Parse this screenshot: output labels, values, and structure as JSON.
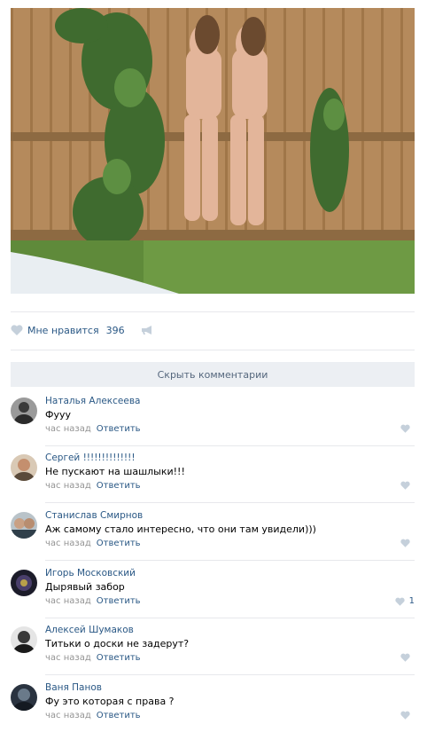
{
  "post": {
    "likes_label": "Мне нравится",
    "likes_count": "396",
    "hide_comments_label": "Скрыть комментарии"
  },
  "colors": {
    "link": "#2a5885",
    "muted": "#939393",
    "icon": "#c5d0db",
    "button_bg": "#eceff3"
  },
  "comments": [
    {
      "author": "Наталья Алексеева",
      "text": "Фууу",
      "time": "час назад",
      "reply": "Ответить",
      "likes": ""
    },
    {
      "author": "Сергей !!!!!!!!!!!!!!",
      "text": "Не пускают на шашлыки!!!",
      "time": "час назад",
      "reply": "Ответить",
      "likes": ""
    },
    {
      "author": "Станислав Смирнов",
      "text": "Аж самому стало интересно, что они там увидели)))",
      "time": "час назад",
      "reply": "Ответить",
      "likes": ""
    },
    {
      "author": "Игорь Московский",
      "text": "Дырявый забор",
      "time": "час назад",
      "reply": "Ответить",
      "likes": "1"
    },
    {
      "author": "Алексей Шумаков",
      "text": "Титьки о доски не задерут?",
      "time": "час назад",
      "reply": "Ответить",
      "likes": ""
    },
    {
      "author": "Ваня Панов",
      "text": "Фу это которая с права ?",
      "time": "час назад",
      "reply": "Ответить",
      "likes": ""
    }
  ]
}
